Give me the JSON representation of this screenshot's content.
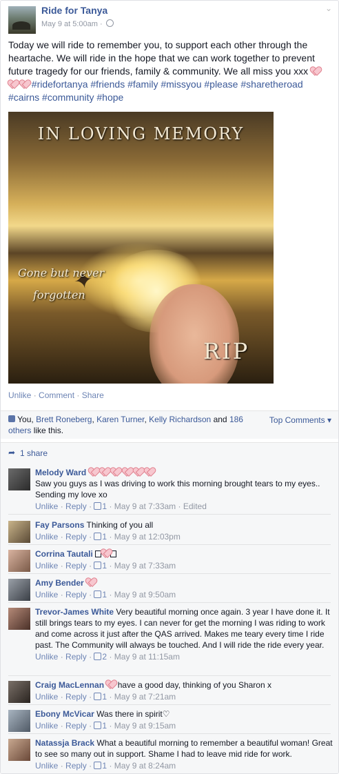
{
  "post": {
    "page_name": "Ride for Tanya",
    "date": "May 9 at 5:00am",
    "dot": "·",
    "status_text": "Today we will ride to remember you, to support each other through the heartache. We will ride in the hope that we can work together to prevent future tragedy for our friends, family & community. We all miss you xxx",
    "hashtags": [
      "#ridefortanya",
      "#friends",
      "#family",
      "#missyou",
      "#please",
      "#sharetheroad",
      "#cairns",
      "#community",
      "#hope"
    ],
    "photo": {
      "title": "IN LOVING MEMORY",
      "caption_line1": "Gone but never",
      "caption_line2": "forgotten",
      "rip": "RIP"
    },
    "actions": {
      "unlike": "Unlike",
      "comment": "Comment",
      "share": "Share",
      "sep": "·"
    },
    "likes": {
      "you": "You,",
      "names": [
        "Brett Roneberg",
        "Karen Turner",
        "Kelly Richardson"
      ],
      "and": "and",
      "others": "186 others",
      "suffix": "like this."
    },
    "top_comments": "Top Comments",
    "shares": "1 share"
  },
  "comments": [
    {
      "name": "Melody Ward",
      "text": "Saw you guys as I was driving to work this morning brought tears to my eyes.. Sending my love xo",
      "likes": "1",
      "time": "May 9 at 7:33am",
      "edited": "Edited"
    },
    {
      "name": "Fay Parsons",
      "text": "Thinking of you all",
      "likes": "1",
      "time": "May 9 at 12:03pm"
    },
    {
      "name": "Corrina Tautali",
      "text": "",
      "likes": "1",
      "time": "May 9 at 7:33am"
    },
    {
      "name": "Amy Bender",
      "text": "",
      "likes": "1",
      "time": "May 9 at 9:50am"
    },
    {
      "name": "Trevor-James White",
      "text": "Very beautiful morning once again. 3 year I have done it. It still brings tears to my eyes. I can never for get the morning I was riding to work and come across it just after the QAS arrived. Makes me teary every time I ride past. The Community will always be touched. And I will ride the ride every year.",
      "likes": "2",
      "time": "May 9 at 11:15am"
    },
    {
      "name": "Craig MacLennan",
      "text": "have a good day, thinking of you Sharon x",
      "likes": "1",
      "time": "May 9 at 7:21am"
    },
    {
      "name": "Ebony McVicar",
      "text": "Was there in spirit♡",
      "likes": "1",
      "time": "May 9 at 9:15am"
    },
    {
      "name": "Natassja Brack",
      "text": "What a beautiful morning to remember a beautiful woman! Great to see so many out in support. Shame I had to leave mid ride for work.",
      "likes": "1",
      "time": "May 9 at 8:24am"
    }
  ],
  "comment_actions": {
    "unlike": "Unlike",
    "reply": "Reply",
    "sep": "·"
  },
  "colors": {
    "link": "#3b5998",
    "muted": "#9197a3",
    "heart_fill": "#f7c7cf",
    "heart_stroke": "#e0808e"
  },
  "icons": [
    "globe-icon",
    "chevron-down-icon",
    "like-thumb-icon",
    "share-arrow-icon",
    "heart-emoji-icon"
  ]
}
